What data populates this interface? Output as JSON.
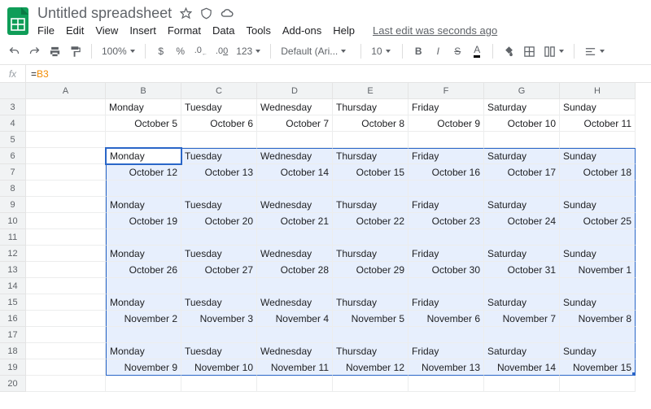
{
  "doc_title": "Untitled spreadsheet",
  "menus": [
    "File",
    "Edit",
    "View",
    "Insert",
    "Format",
    "Data",
    "Tools",
    "Add-ons",
    "Help"
  ],
  "last_edit": "Last edit was seconds ago",
  "toolbar": {
    "zoom": "100%",
    "currency": "$",
    "percent": "%",
    "dec_dec": ".0",
    "inc_dec": ".00",
    "fmt123": "123",
    "font": "Default (Ari...",
    "size": "10",
    "bold": "B",
    "italic": "I",
    "strike": "S",
    "fontcolor": "A"
  },
  "formula_prefix": "=",
  "formula_ref": "B3",
  "cols": [
    "A",
    "B",
    "C",
    "D",
    "E",
    "F",
    "G",
    "H"
  ],
  "rows": [
    3,
    4,
    5,
    6,
    7,
    8,
    9,
    10,
    11,
    12,
    13,
    14,
    15,
    16,
    17,
    18,
    19,
    20
  ],
  "days": [
    "Monday",
    "Tuesday",
    "Wednesday",
    "Thursday",
    "Friday",
    "Saturday",
    "Sunday"
  ],
  "dates": {
    "3": [
      "October 5",
      "October 6",
      "October 7",
      "October 8",
      "October 9",
      "October 10",
      "October 11"
    ],
    "6": [
      "October 12",
      "October 13",
      "October 14",
      "October 15",
      "October 16",
      "October 17",
      "October 18"
    ],
    "9": [
      "October 19",
      "October 20",
      "October 21",
      "October 22",
      "October 23",
      "October 24",
      "October 25"
    ],
    "12": [
      "October 26",
      "October 27",
      "October 28",
      "October 29",
      "October 30",
      "October 31",
      "November 1"
    ],
    "15": [
      "November 2",
      "November 3",
      "November 4",
      "November 5",
      "November 6",
      "November 7",
      "November 8"
    ],
    "18": [
      "November 9",
      "November 10",
      "November 11",
      "November 12",
      "November 13",
      "November 14",
      "November 15"
    ]
  },
  "day_rows": [
    3,
    6,
    9,
    12,
    15,
    18
  ],
  "date_rows": [
    4,
    7,
    10,
    13,
    16,
    19
  ],
  "sel": {
    "r1": 6,
    "r2": 19
  },
  "active": {
    "row": 6,
    "col": 1
  }
}
